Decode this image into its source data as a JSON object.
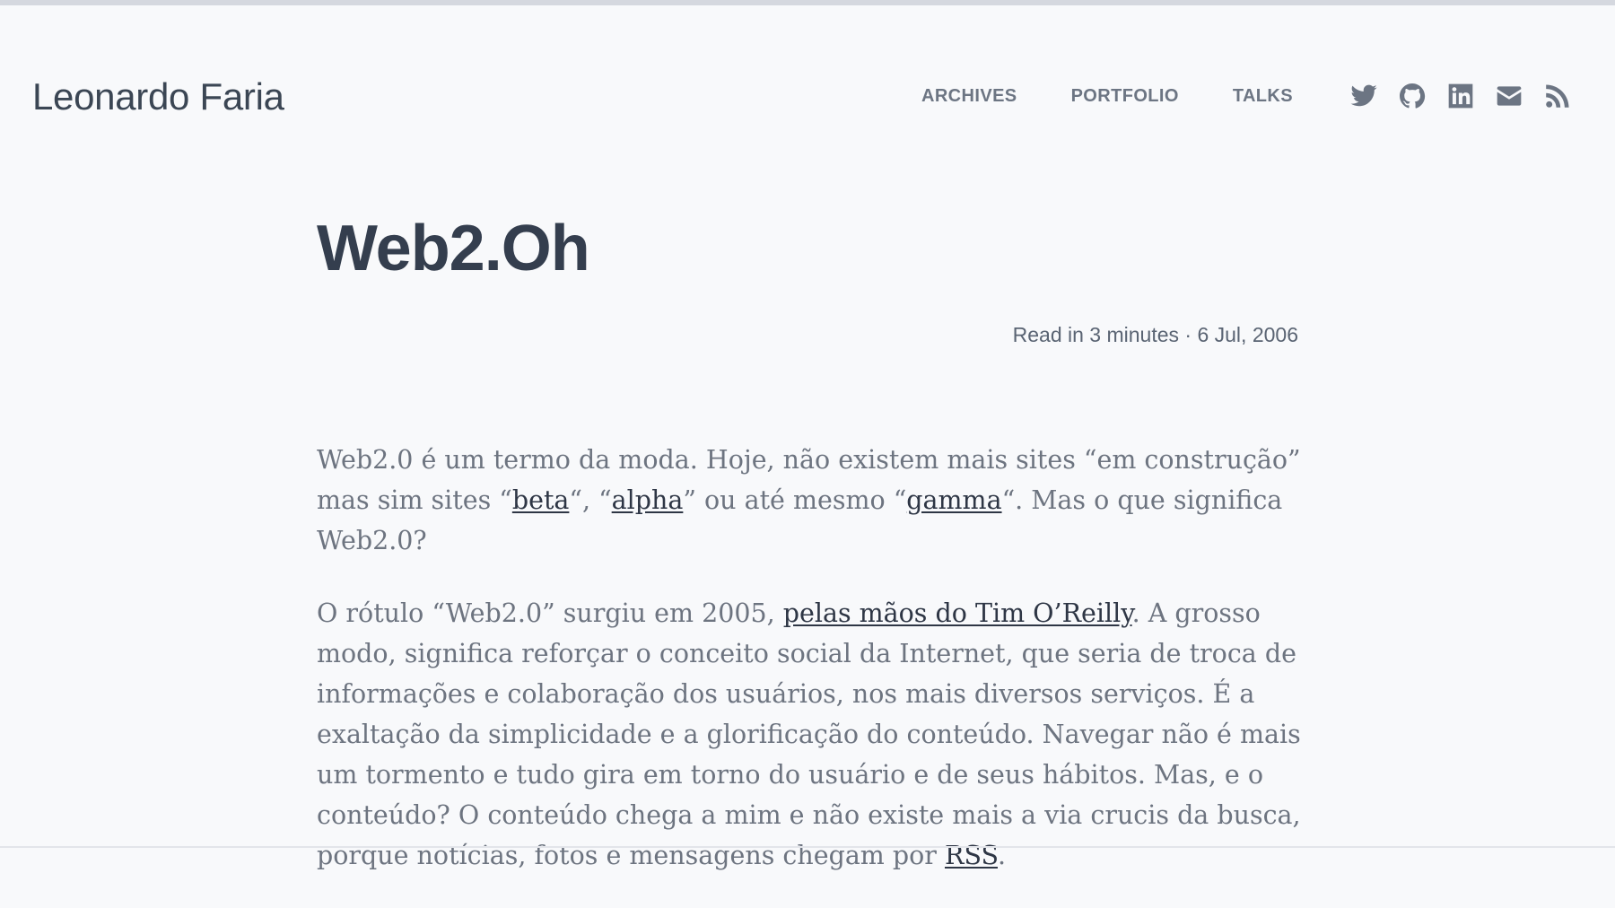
{
  "site": {
    "title": "Leonardo Faria"
  },
  "nav": {
    "items": [
      {
        "label": "ARCHIVES"
      },
      {
        "label": "PORTFOLIO"
      },
      {
        "label": "TALKS"
      }
    ]
  },
  "social": {
    "icons": [
      "twitter-icon",
      "github-icon",
      "linkedin-icon",
      "email-icon",
      "rss-icon"
    ],
    "color": "#6c7583"
  },
  "post": {
    "title": "Web2.Oh",
    "meta": "Read in 3 minutes · 6 Jul, 2006",
    "p1": {
      "t1": "Web2.0 é um termo da moda. Hoje, não existem mais sites “em construção” mas sim sites “",
      "link_beta": "beta",
      "t2": "“, “",
      "link_alpha": "alpha",
      "t3": "” ou até mesmo “",
      "link_gamma": "gamma",
      "t4": "“. Mas o que significa Web2.0?"
    },
    "p2": {
      "t1": "O rótulo “Web2.0” surgiu em 2005, ",
      "link_oreilly": "pelas mãos do Tim O’Reilly",
      "t2": ". A grosso modo, significa reforçar o conceito social da Internet, que seria de troca de informações e colaboração dos usuários, nos mais diversos serviços. É a exaltação da simplicidade e a glorificação do conteúdo. Navegar não é mais um tormento e tudo gira em torno do usuário e de seus hábitos. Mas, e o conteúdo? O conteúdo chega a mim e não existe mais a via crucis da busca, porque notícias, fotos e mensagens chegam por ",
      "link_rss": "RSS",
      "t3": "."
    }
  },
  "colors": {
    "background": "#f8f9fb",
    "heading": "#343e4e",
    "body_text": "#6d7480",
    "link": "#2e3645"
  }
}
